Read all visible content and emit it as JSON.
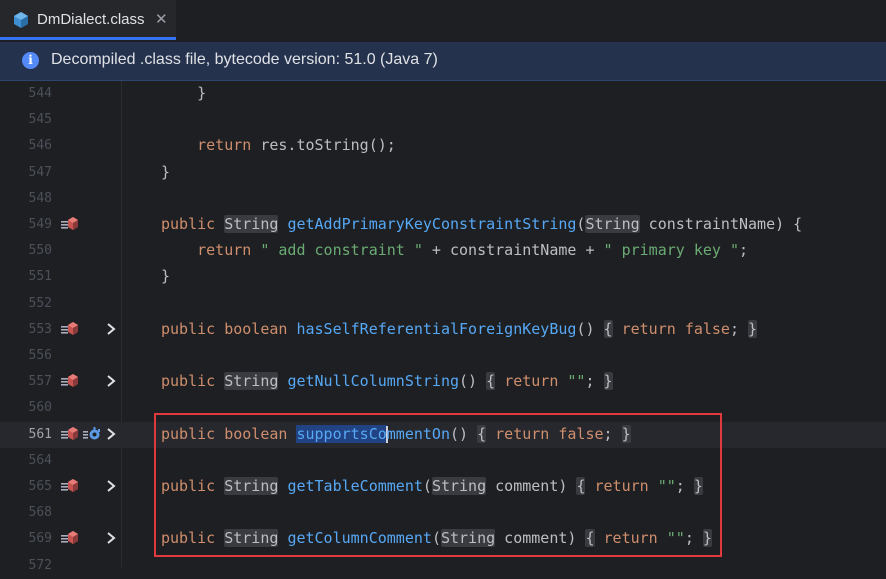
{
  "tab": {
    "title": "DmDialect.class",
    "close_glyph": "✕"
  },
  "banner": {
    "icon_glyph": "i",
    "text": "Decompiled .class file, bytecode version: 51.0 (Java 7)"
  },
  "lines": [
    {
      "n": "544",
      "code": "    }"
    },
    {
      "n": "545",
      "code": ""
    },
    {
      "n": "546",
      "code": "    return res.toString();"
    },
    {
      "n": "547",
      "code": "}"
    },
    {
      "n": "548",
      "code": ""
    },
    {
      "n": "549",
      "code": "public String getAddPrimaryKeyConstraintString(String constraintName) {"
    },
    {
      "n": "550",
      "code": "    return \" add constraint \" + constraintName + \" primary key \";"
    },
    {
      "n": "551",
      "code": "}"
    },
    {
      "n": "552",
      "code": ""
    },
    {
      "n": "553",
      "code": "public boolean hasSelfReferentialForeignKeyBug() { return false; }"
    },
    {
      "n": "556",
      "code": ""
    },
    {
      "n": "557",
      "code": "public String getNullColumnString() { return \"\"; }"
    },
    {
      "n": "560",
      "code": ""
    },
    {
      "n": "561",
      "code": "public boolean supportsCommentOn() { return false; }"
    },
    {
      "n": "564",
      "code": ""
    },
    {
      "n": "565",
      "code": "public String getTableComment(String comment) { return \"\"; }"
    },
    {
      "n": "568",
      "code": ""
    },
    {
      "n": "569",
      "code": "public String getColumnComment(String comment) { return \"\"; }"
    },
    {
      "n": "572",
      "code": ""
    }
  ],
  "colors": {
    "keyword": "#cf8e6d",
    "function": "#56a8f5",
    "string": "#6aab73",
    "text": "#bcbec4",
    "highlight_box": "#e0393e",
    "selection": "#214283"
  },
  "icons": {
    "file": "class-file-icon",
    "info": "info-icon",
    "override": "override-method-icon",
    "debug": "debug-method-icon",
    "fold": "chevron-right-icon"
  }
}
